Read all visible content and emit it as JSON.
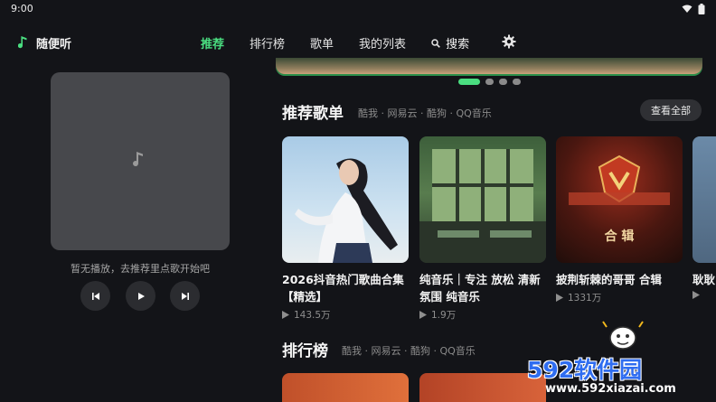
{
  "status": {
    "time": "9:00"
  },
  "app": {
    "name": "随便听"
  },
  "nav": {
    "tabs": [
      "推荐",
      "排行榜",
      "歌单",
      "我的列表"
    ],
    "search_label": "搜索"
  },
  "player": {
    "empty_text": "暂无播放，去推荐里点歌开始吧"
  },
  "sections": {
    "playlists": {
      "title": "推荐歌单",
      "sources": "酷我 · 网易云 · 酷狗 · QQ音乐",
      "view_all": "查看全部",
      "items": [
        {
          "title": "2026抖音热门歌曲合集【精选】",
          "plays": "143.5万"
        },
        {
          "title": "纯音乐｜专注 放松 清新 氛围 纯音乐",
          "plays": "1.9万"
        },
        {
          "title": "披荆斩棘的哥哥 合辑",
          "plays": "1331万"
        },
        {
          "title": "耿耿",
          "plays": ""
        }
      ],
      "cover3_text": "合 辑"
    },
    "charts": {
      "title": "排行榜",
      "sources": "酷我 · 网易云 · 酷狗 · QQ音乐"
    }
  },
  "banner": {
    "active_index": 0,
    "count": 4
  },
  "watermark": {
    "logo": "592软件园",
    "url": "www.592xiazai.com"
  },
  "colors": {
    "accent": "#4ade80",
    "background": "#131418"
  }
}
